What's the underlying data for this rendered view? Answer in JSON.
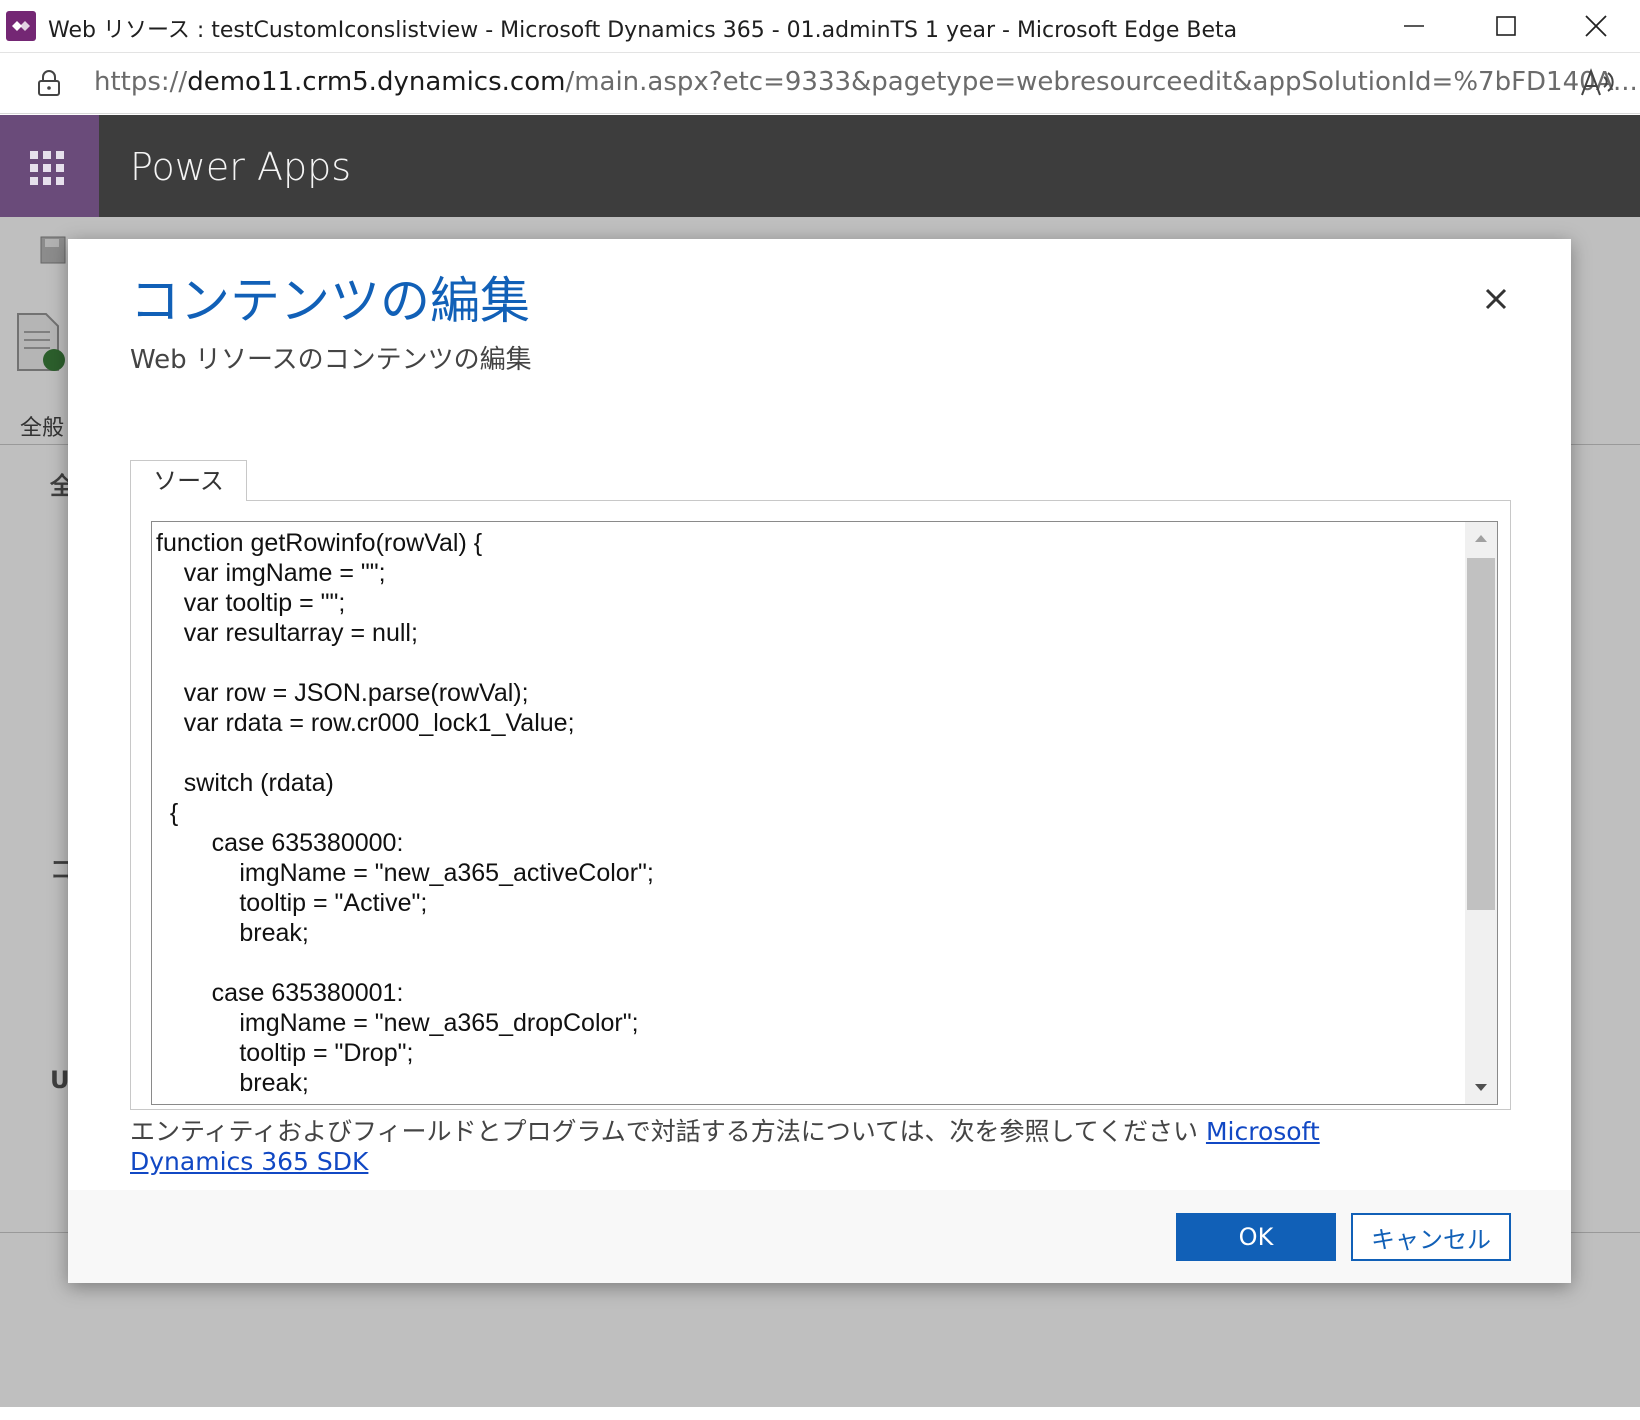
{
  "window": {
    "title": "Web リソース : testCustomIconslistview - Microsoft Dynamics 365 - 01.adminTS 1 year - Microsoft Edge Beta",
    "minimize_icon": "minimize-icon",
    "maximize_icon": "maximize-icon",
    "close_icon": "close-icon"
  },
  "address_bar": {
    "scheme": "https://",
    "host": "demo11.crm5.dynamics.com",
    "path": "/main.aspx?etc=9333&pagetype=webresourceedit&appSolutionId=%7bFD140A..."
  },
  "app_header": {
    "app_name": "Power Apps"
  },
  "background": {
    "tab_label": "全般",
    "chars": [
      "全",
      "コ",
      "U"
    ]
  },
  "dialog": {
    "title": "コンテンツの編集",
    "subtitle": "Web リソースのコンテンツの編集",
    "tab_label": "ソース",
    "code": "function getRowinfo(rowVal) {\n    var imgName = \"\";\n    var tooltip = \"\";\n    var resultarray = null;\n\n    var row = JSON.parse(rowVal);\n    var rdata = row.cr000_lock1_Value;\n\n    switch (rdata)\n  {\n        case 635380000:\n            imgName = \"new_a365_activeColor\";\n            tooltip = \"Active\";\n            break;\n\n        case 635380001:\n            imgName = \"new_a365_dropColor\";\n            tooltip = \"Drop\";\n            break;",
    "sdk_note_text": "エンティティおよびフィールドとプログラムで対話する方法については、次を参照してください ",
    "sdk_link_text": "Microsoft Dynamics 365 SDK",
    "ok_label": "OK",
    "cancel_label": "キャンセル"
  },
  "colors": {
    "accent": "#1160b7",
    "app_header": "#3d3d3d",
    "waffle": "#6a4b7a"
  }
}
